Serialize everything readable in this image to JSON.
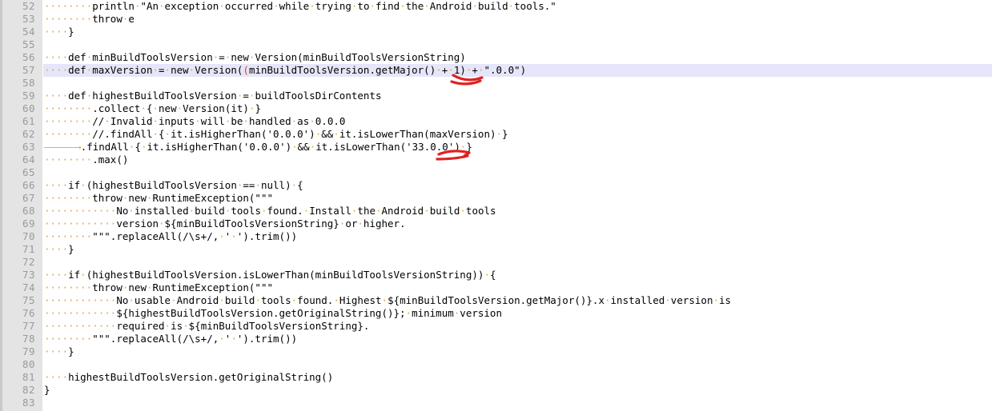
{
  "editor": {
    "kind": "code-editor",
    "language": "Groovy",
    "first_line": 52,
    "last_line": 83,
    "current_line": 57,
    "colors": {
      "background": "#ffffff",
      "gutter": "#e4e4e4",
      "line_number": "#9a9a9a",
      "text": "#000000",
      "whitespace_marker": "#e8a33d",
      "current_line_highlight": "#e6e6fa",
      "selection": "#bdb9b0",
      "bracket": "#dd4411",
      "annotation": "#e02020"
    },
    "selection_text": "+ 1"
  },
  "lines": [
    {
      "n": "52",
      "text": "        println \"An exception occurred while trying to find the Android build tools.\""
    },
    {
      "n": "53",
      "text": "        throw e"
    },
    {
      "n": "54",
      "text": "    }"
    },
    {
      "n": "55",
      "text": ""
    },
    {
      "n": "56",
      "text": "    def minBuildToolsVersion = new Version(minBuildToolsVersionString)"
    },
    {
      "n": "57",
      "text": "    def maxVersion = new Version((minBuildToolsVersion.getMajor() + 1) + \".0.0\")"
    },
    {
      "n": "58",
      "text": ""
    },
    {
      "n": "59",
      "text": "    def highestBuildToolsVersion = buildToolsDirContents"
    },
    {
      "n": "60",
      "text": "        .collect { new Version(it) }"
    },
    {
      "n": "61",
      "text": "        // Invalid inputs will be handled as 0.0.0"
    },
    {
      "n": "62",
      "text": "        //.findAll { it.isHigherThan('0.0.0') && it.isLowerThan(maxVersion) }"
    },
    {
      "n": "63",
      "text": "\t.findAll { it.isHigherThan('0.0.0') && it.isLowerThan('33.0.0') }"
    },
    {
      "n": "64",
      "text": "        .max()"
    },
    {
      "n": "65",
      "text": ""
    },
    {
      "n": "66",
      "text": "    if (highestBuildToolsVersion == null) {"
    },
    {
      "n": "67",
      "text": "        throw new RuntimeException(\"\"\""
    },
    {
      "n": "68",
      "text": "            No installed build tools found. Install the Android build tools"
    },
    {
      "n": "69",
      "text": "            version ${minBuildToolsVersionString} or higher."
    },
    {
      "n": "70",
      "text": "        \"\"\".replaceAll(/\\s+/, ' ').trim())"
    },
    {
      "n": "71",
      "text": "    }"
    },
    {
      "n": "72",
      "text": ""
    },
    {
      "n": "73",
      "text": "    if (highestBuildToolsVersion.isLowerThan(minBuildToolsVersionString)) {"
    },
    {
      "n": "74",
      "text": "        throw new RuntimeException(\"\"\""
    },
    {
      "n": "75",
      "text": "            No usable Android build tools found. Highest ${minBuildToolsVersion.getMajor()}.x installed version is"
    },
    {
      "n": "76",
      "text": "            ${highestBuildToolsVersion.getOriginalString()}; minimum version"
    },
    {
      "n": "77",
      "text": "            required is ${minBuildToolsVersionString}."
    },
    {
      "n": "78",
      "text": "        \"\"\".replaceAll(/\\s+/, ' ').trim())"
    },
    {
      "n": "79",
      "text": "    }"
    },
    {
      "n": "80",
      "text": ""
    },
    {
      "n": "81",
      "text": "    highestBuildToolsVersion.getOriginalString()"
    },
    {
      "n": "82",
      "text": "}"
    },
    {
      "n": "83",
      "text": ""
    }
  ],
  "annotations": [
    {
      "id": "annot-plus-one",
      "target": "+ 1",
      "line": "57",
      "shape": "double-red-stroke"
    },
    {
      "id": "annot-33-0-0",
      "target": "'33.0.0'",
      "line": "63",
      "shape": "double-red-stroke"
    }
  ]
}
